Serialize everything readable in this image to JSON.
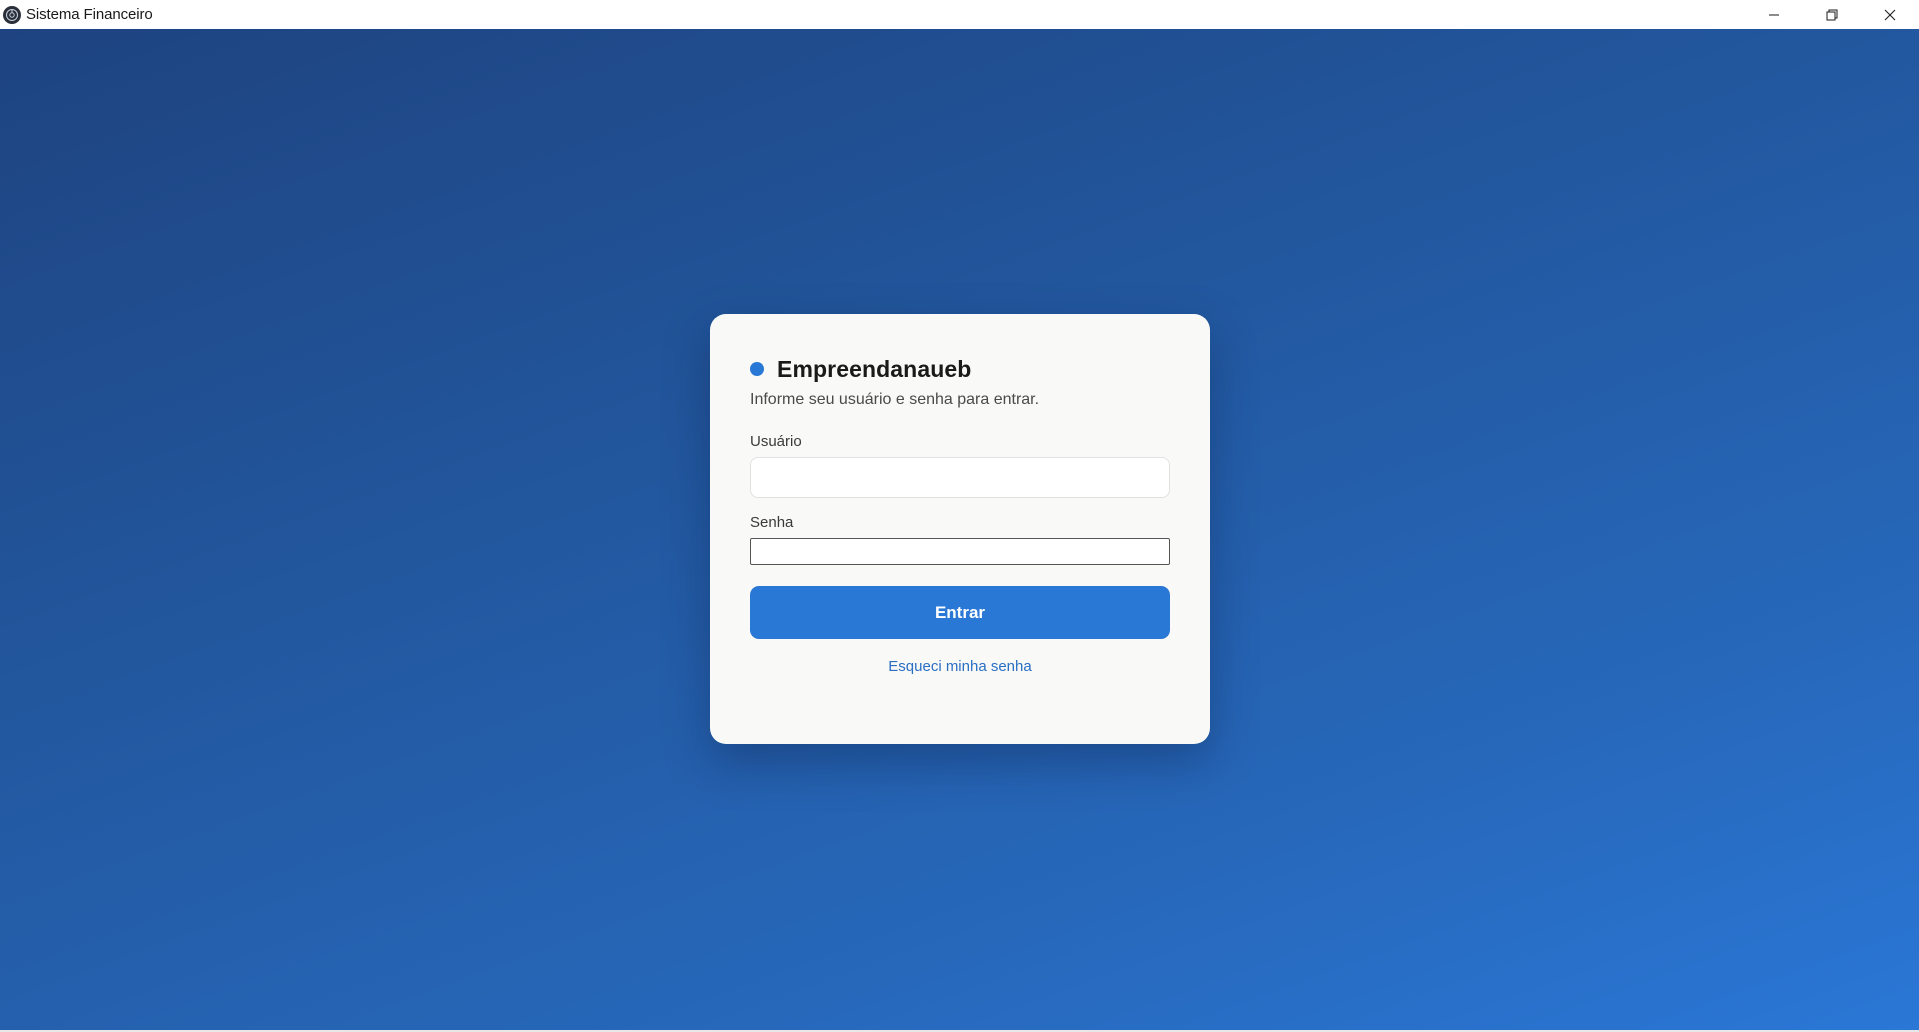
{
  "window": {
    "title": "Sistema Financeiro",
    "icon": "app-logo-icon",
    "controls": {
      "minimize_icon": "minimize-icon",
      "maximize_icon": "restore-icon",
      "close_icon": "close-icon"
    }
  },
  "colors": {
    "accent": "#2a78d6",
    "background_start": "#1e4380",
    "background_end": "#2a77d6",
    "card_background": "#f9f9f7",
    "link": "#2a6fc4"
  },
  "login": {
    "brand_name": "Empreendanaueb",
    "subtitle": "Informe seu usuário e senha para entrar.",
    "username_label": "Usuário",
    "username_value": "",
    "password_label": "Senha",
    "password_value": "",
    "submit_label": "Entrar",
    "forgot_password_label": "Esqueci minha senha"
  }
}
